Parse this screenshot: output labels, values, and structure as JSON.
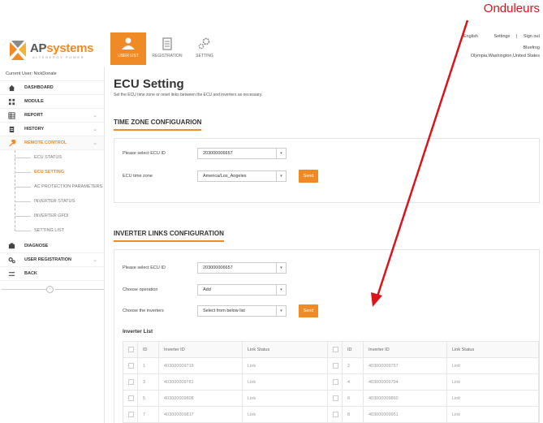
{
  "annotation": {
    "text": "Onduleurs",
    "color": "#d9141a"
  },
  "brand": {
    "name_part1": "AP",
    "name_part2": "systems",
    "tagline": "ALTENERGY POWER",
    "accent_color": "#f08a24"
  },
  "nav_tabs": [
    {
      "label": "USER LIST",
      "icon": "user-list-icon",
      "active": true
    },
    {
      "label": "REGISTRATION",
      "icon": "registration-icon",
      "active": false
    },
    {
      "label": "SETTING",
      "icon": "setting-icon",
      "active": false
    }
  ],
  "top_links": {
    "language": "English",
    "separator": "|",
    "settings": "Settings",
    "signout": "Sign out"
  },
  "user_info": {
    "name": "Bluefrog",
    "location": "Olympia,Washington,United States"
  },
  "sidebar": {
    "current_user": "Current User: NickDonale",
    "items": [
      {
        "label": "DASHBOARD",
        "icon": "home-icon",
        "chevron": ""
      },
      {
        "label": "MODULE",
        "icon": "grid-icon",
        "chevron": ""
      },
      {
        "label": "REPORT",
        "icon": "table-icon",
        "chevron": "⌄"
      },
      {
        "label": "HISTORY",
        "icon": "history-icon",
        "chevron": "⌄"
      },
      {
        "label": "REMOTE CONTROL",
        "icon": "wrench-icon",
        "chevron": "⌄"
      }
    ],
    "sub_items": [
      {
        "label": "ECU STATUS",
        "active": false
      },
      {
        "label": "ECU SETTING",
        "active": true
      },
      {
        "label": "AC PROTECTION PARAMETERS",
        "active": false
      },
      {
        "label": "INVERTER STATUS",
        "active": false
      },
      {
        "label": "INVERTER GFDI",
        "active": false
      },
      {
        "label": "SETTING LIST",
        "active": false
      }
    ],
    "items_after": [
      {
        "label": "DIAGNOSE",
        "icon": "diagnose-icon",
        "chevron": ""
      },
      {
        "label": "USER REGISTRATION",
        "icon": "gears-icon",
        "chevron": "⌄"
      },
      {
        "label": "BACK",
        "icon": "back-icon",
        "chevron": ""
      }
    ],
    "collapse_symbol": "‹"
  },
  "page": {
    "title": "ECU Setting",
    "description": "Set the ECU time zone or reset links between the ECU and inverters as necessary."
  },
  "timezone": {
    "section_title": "TIME ZONE CONFIGUARION",
    "ecu_label": "Please select ECU ID",
    "ecu_value": "203000006657",
    "tz_label": "ECU time zone",
    "tz_value": "America/Los_Angeles",
    "send_label": "Send"
  },
  "inverter_links": {
    "section_title": "INVERTER LINKS CONFIGURATION",
    "ecu_label": "Please select ECU ID",
    "ecu_value": "203000006657",
    "operation_label": "Choose operation",
    "operation_value": "Add",
    "inverters_label": "Choose the inverters",
    "inverters_value": "Select from below list",
    "send_label": "Send",
    "list_label": "Inverter List",
    "columns": [
      "ID",
      "Inverter ID",
      "Link Status",
      "ID",
      "Inverter ID",
      "Link Status"
    ],
    "rows": [
      [
        "1",
        "403000009719",
        "Link",
        "2",
        "403000009757",
        "Link"
      ],
      [
        "3",
        "403000009781",
        "Link",
        "4",
        "403000009794",
        "Link"
      ],
      [
        "5",
        "403000009808",
        "Link",
        "6",
        "403000009860",
        "Link"
      ],
      [
        "7",
        "403000009817",
        "Link",
        "8",
        "403000009951",
        "Link"
      ]
    ]
  }
}
